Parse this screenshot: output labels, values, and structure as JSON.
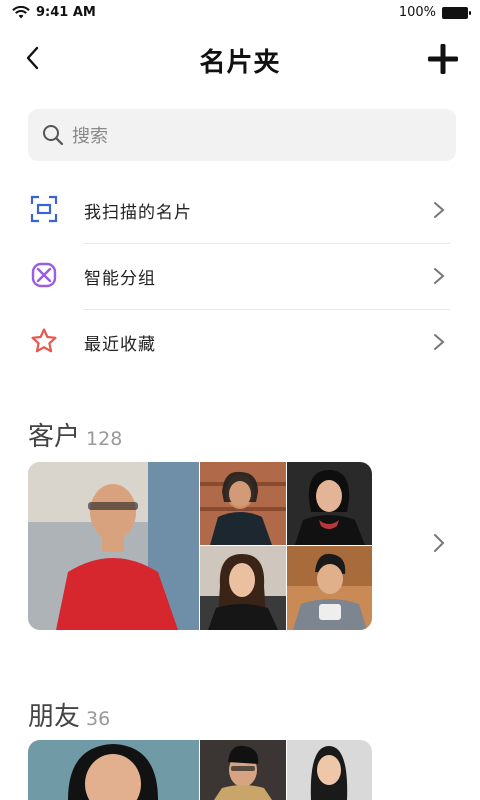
{
  "status_bar": {
    "time": "9:41 AM",
    "battery": "100%"
  },
  "nav": {
    "title": "名片夹"
  },
  "search": {
    "placeholder": "搜索"
  },
  "menu": [
    {
      "label": "我扫描的名片",
      "icon": "scan-icon",
      "color": "#3b63d8"
    },
    {
      "label": "智能分组",
      "icon": "smart-group-icon",
      "color": "#9b5de5"
    },
    {
      "label": "最近收藏",
      "icon": "star-icon",
      "color": "#e8584d"
    }
  ],
  "groups": [
    {
      "title": "客户",
      "count": "128"
    },
    {
      "title": "朋友",
      "count": "36"
    }
  ]
}
